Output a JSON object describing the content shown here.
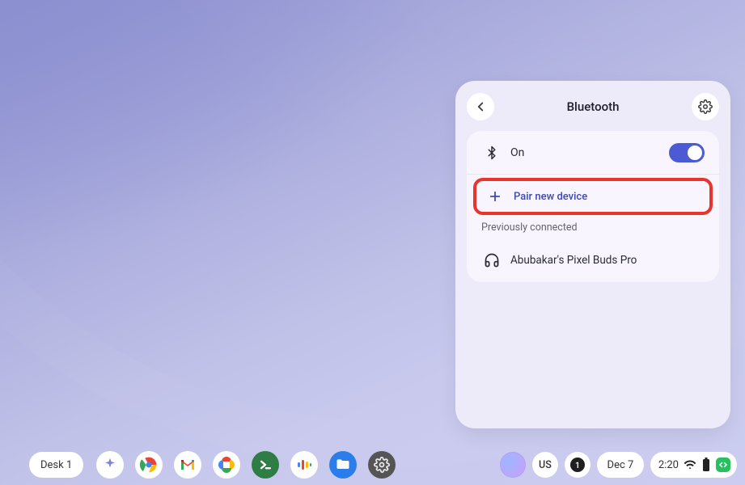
{
  "panel": {
    "title": "Bluetooth",
    "status_label": "On",
    "toggle_on": true,
    "pair_label": "Pair new device",
    "section_caption": "Previously connected",
    "devices": [
      {
        "name": "Abubakar's Pixel Buds Pro"
      }
    ]
  },
  "shelf": {
    "desk_label": "Desk 1",
    "apps": [
      {
        "id": "assistant",
        "name": "Assistant"
      },
      {
        "id": "chrome",
        "name": "Chrome"
      },
      {
        "id": "gmail",
        "name": "Gmail"
      },
      {
        "id": "photos",
        "name": "Photos"
      },
      {
        "id": "terminal",
        "name": "Terminal"
      },
      {
        "id": "voice",
        "name": "Voice"
      },
      {
        "id": "files",
        "name": "Files"
      },
      {
        "id": "settings",
        "name": "Settings"
      }
    ],
    "tray": {
      "input_method": "US",
      "notifications": "1",
      "date": "Dec 7",
      "time": "2:20"
    }
  }
}
